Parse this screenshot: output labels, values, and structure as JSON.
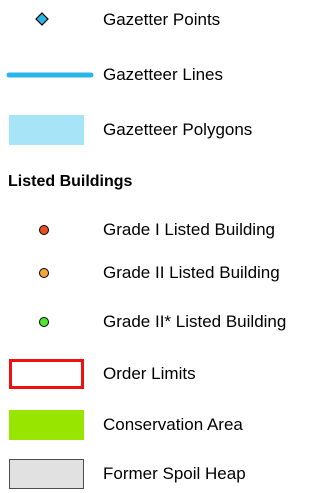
{
  "legend": {
    "items": [
      {
        "label": "Gazetter Points",
        "symbol": "diamond",
        "fill": "#29b6e8",
        "stroke": "#000000"
      },
      {
        "label": "Gazetteer Lines",
        "symbol": "line",
        "stroke": "#29b6e8"
      },
      {
        "label": "Gazetteer Polygons",
        "symbol": "polygon",
        "fill": "#a8e4f8",
        "stroke": "#a8e4f8"
      }
    ],
    "group_heading": "Listed Buildings",
    "listed": [
      {
        "label": "Grade I Listed Building",
        "symbol": "circle",
        "fill": "#e8501e"
      },
      {
        "label": "Grade II Listed Building",
        "symbol": "circle",
        "fill": "#f4a23a"
      },
      {
        "label": "Grade II* Listed Building",
        "symbol": "circle",
        "fill": "#4ee82a"
      }
    ],
    "areas": [
      {
        "label": "Order Limits",
        "symbol": "outline-box",
        "fill": "#ffffff",
        "stroke": "#ee1111"
      },
      {
        "label": "Conservation Area",
        "symbol": "filled-box",
        "fill": "#98e600",
        "stroke": "#98e600"
      },
      {
        "label": "Former Spoil Heap",
        "symbol": "filled-box",
        "fill": "#e1e1e1",
        "stroke": "#4d4d4d"
      }
    ]
  }
}
